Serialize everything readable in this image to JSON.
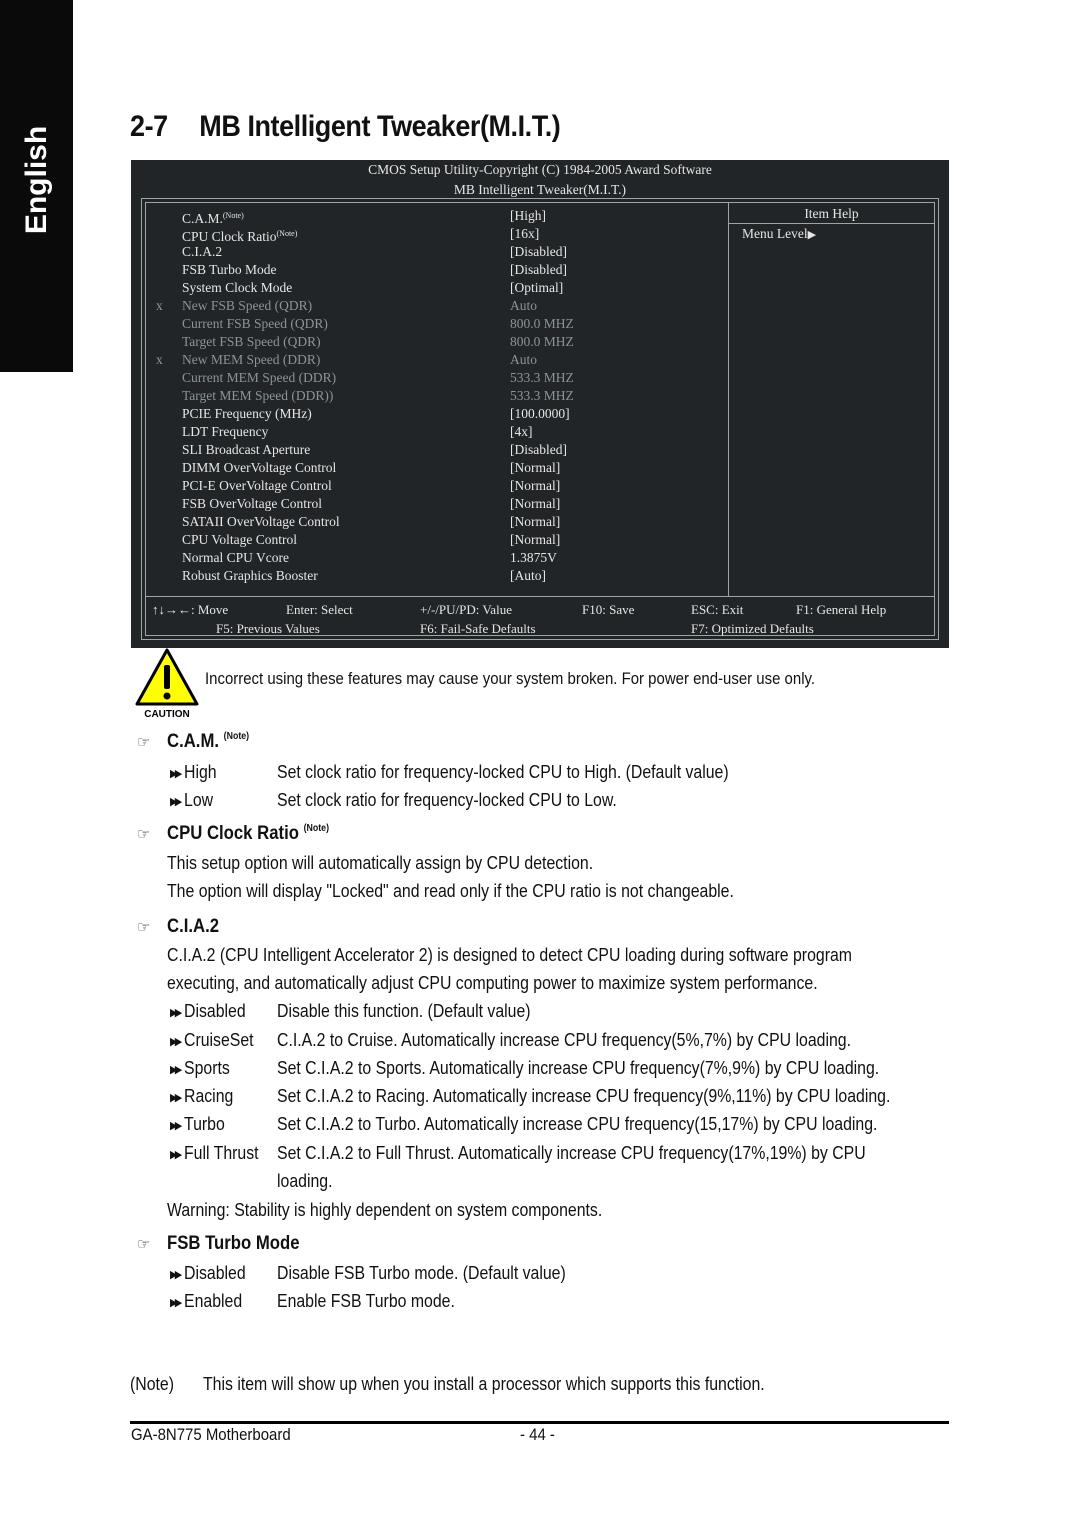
{
  "side_tab": "English",
  "title": {
    "number": "2-7",
    "text": "MB Intelligent Tweaker(M.I.T.)"
  },
  "bios": {
    "header_line1": "CMOS Setup Utility-Copyright (C) 1984-2005 Award Software",
    "header_line2": "MB Intelligent Tweaker(M.I.T.)",
    "items": [
      {
        "mark": "",
        "label": "C.A.M.",
        "note": "(Note)",
        "value": "[High]",
        "dim": false
      },
      {
        "mark": "",
        "label": "CPU Clock Ratio",
        "note": "(Note)",
        "value": "[16x]",
        "dim": false
      },
      {
        "mark": "",
        "label": "C.I.A.2",
        "note": "",
        "value": "[Disabled]",
        "dim": false
      },
      {
        "mark": "",
        "label": "FSB Turbo Mode",
        "note": "",
        "value": "[Disabled]",
        "dim": false
      },
      {
        "mark": "",
        "label": "System Clock Mode",
        "note": "",
        "value": "[Optimal]",
        "dim": false
      },
      {
        "mark": "x",
        "label": "New FSB Speed (QDR)",
        "note": "",
        "value": "Auto",
        "dim": true
      },
      {
        "mark": "",
        "label": "Current FSB Speed (QDR)",
        "note": "",
        "value": " 800.0 MHZ",
        "dim": true
      },
      {
        "mark": "",
        "label": "Target FSB Speed (QDR)",
        "note": "",
        "value": " 800.0 MHZ",
        "dim": true
      },
      {
        "mark": "x",
        "label": "New MEM Speed (DDR)",
        "note": "",
        "value": "Auto",
        "dim": true
      },
      {
        "mark": "",
        "label": "Current MEM Speed (DDR)",
        "note": "",
        "value": " 533.3 MHZ",
        "dim": true
      },
      {
        "mark": "",
        "label": "Target MEM Speed (DDR))",
        "note": "",
        "value": " 533.3 MHZ",
        "dim": true
      },
      {
        "mark": "",
        "label": "PCIE Frequency (MHz)",
        "note": "",
        "value": "[100.0000]",
        "dim": false
      },
      {
        "mark": "",
        "label": "LDT Frequency",
        "note": "",
        "value": "[4x]",
        "dim": false
      },
      {
        "mark": "",
        "label": "SLI Broadcast Aperture",
        "note": "",
        "value": "[Disabled]",
        "dim": false
      },
      {
        "mark": "",
        "label": "DIMM OverVoltage Control",
        "note": "",
        "value": "[Normal]",
        "dim": false
      },
      {
        "mark": "",
        "label": "PCI-E OverVoltage Control",
        "note": "",
        "value": "[Normal]",
        "dim": false
      },
      {
        "mark": "",
        "label": "FSB OverVoltage Control",
        "note": "",
        "value": "[Normal]",
        "dim": false
      },
      {
        "mark": "",
        "label": "SATAII OverVoltage Control",
        "note": "",
        "value": "[Normal]",
        "dim": false
      },
      {
        "mark": "",
        "label": "CPU Voltage Control",
        "note": "",
        "value": "[Normal]",
        "dim": false
      },
      {
        "mark": "",
        "label": "Normal CPU Vcore",
        "note": "",
        "value": "1.3875V",
        "dim": false
      },
      {
        "mark": "",
        "label": "Robust Graphics Booster",
        "note": "",
        "value": "[Auto]",
        "dim": false
      }
    ],
    "help_title": "Item Help",
    "menu_level": "Menu Level",
    "keys": {
      "move": "↑↓→←: Move",
      "select": "Enter: Select",
      "value": "+/-/PU/PD: Value",
      "save": "F10: Save",
      "exit": "ESC: Exit",
      "help": "F1: General Help",
      "prev": "F5: Previous Values",
      "failsafe": "F6: Fail-Safe Defaults",
      "optimized": "F7: Optimized Defaults"
    }
  },
  "caution": {
    "label": "CAUTION",
    "text": "Incorrect using these features may cause your system broken. For power end-user use only."
  },
  "sections": {
    "cam": {
      "heading": "C.A.M.",
      "note": "(Note)",
      "options": [
        {
          "name": "High",
          "desc": "Set clock ratio for frequency-locked CPU to High. (Default value)"
        },
        {
          "name": "Low",
          "desc": "Set clock ratio for frequency-locked CPU to Low."
        }
      ]
    },
    "cpu_ratio": {
      "heading": "CPU Clock Ratio",
      "note": "(Note)",
      "lines": [
        "This setup option will automatically assign by CPU detection.",
        "The option will display \"Locked\" and read only if the CPU ratio is not changeable."
      ]
    },
    "cia2": {
      "heading": "C.I.A.2",
      "lines": [
        "C.I.A.2 (CPU Intelligent Accelerator 2) is designed to detect CPU loading during software program",
        "executing, and automatically adjust CPU computing power to maximize system performance."
      ],
      "options": [
        {
          "name": "Disabled",
          "desc": "Disable this function. (Default value)"
        },
        {
          "name": "CruiseSet",
          "desc": "C.I.A.2 to Cruise. Automatically increase CPU frequency(5%,7%) by CPU loading."
        },
        {
          "name": "Sports",
          "desc": "Set C.I.A.2 to Sports. Automatically increase CPU frequency(7%,9%) by CPU loading."
        },
        {
          "name": "Racing",
          "desc": "Set C.I.A.2 to Racing. Automatically increase CPU frequency(9%,11%) by CPU loading."
        },
        {
          "name": "Turbo",
          "desc": "Set C.I.A.2 to Turbo. Automatically increase CPU frequency(15,17%) by CPU loading."
        },
        {
          "name": "Full Thrust",
          "desc": "Set C.I.A.2 to Full Thrust. Automatically increase CPU frequency(17%,19%) by CPU",
          "desc2": "loading."
        }
      ],
      "warning": "Warning: Stability is highly dependent on system components."
    },
    "fsb_turbo": {
      "heading": "FSB Turbo Mode",
      "options": [
        {
          "name": "Disabled",
          "desc": "Disable FSB Turbo mode. (Default value)"
        },
        {
          "name": "Enabled",
          "desc": "Enable FSB Turbo mode."
        }
      ]
    }
  },
  "note": {
    "label": "(Note)",
    "text": "This item will show up when you install a processor which supports this function."
  },
  "footer": {
    "model": "GA-8N775 Motherboard",
    "page": "- 44 -"
  }
}
